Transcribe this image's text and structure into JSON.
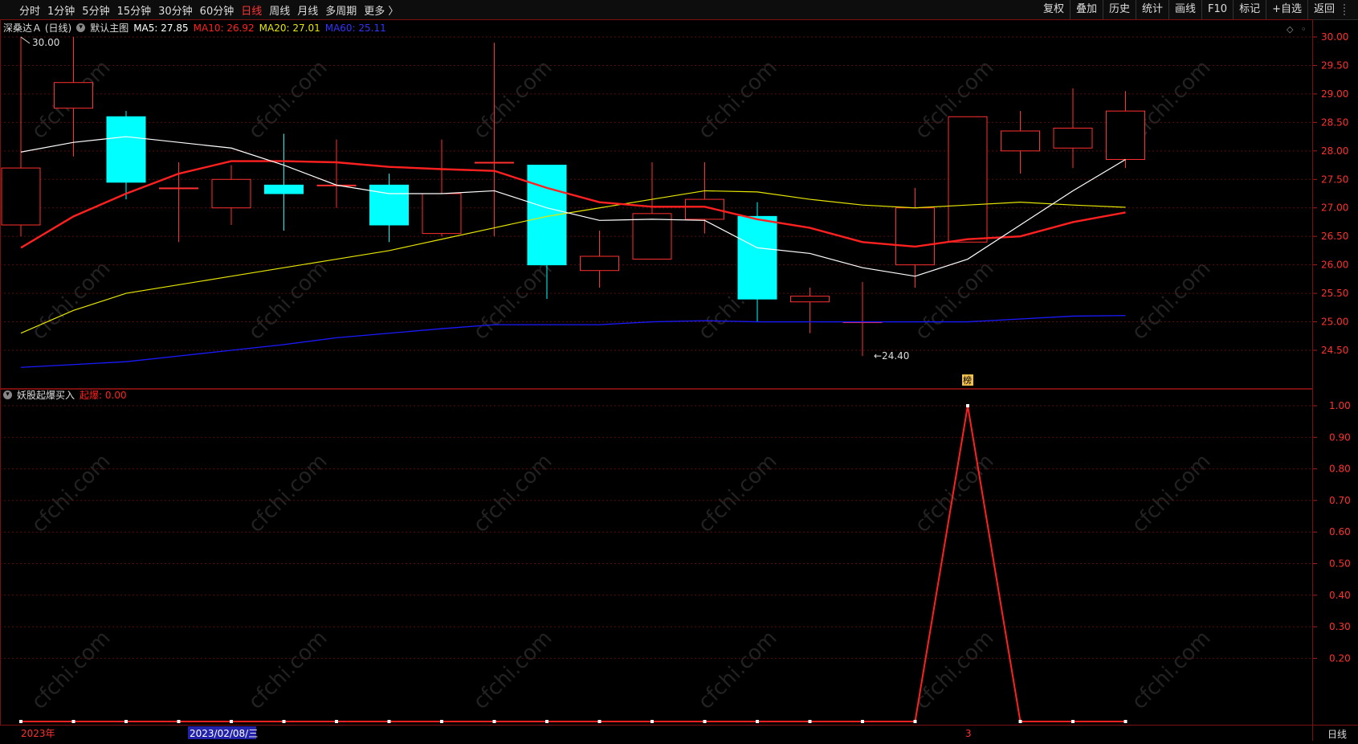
{
  "toolbar": {
    "periods": [
      "分时",
      "1分钟",
      "5分钟",
      "15分钟",
      "30分钟",
      "60分钟",
      "日线",
      "周线",
      "月线",
      "多周期",
      "更多 〉"
    ],
    "active_period": "日线",
    "right_buttons": [
      "复权",
      "叠加",
      "历史",
      "统计",
      "画线",
      "F10",
      "+自选",
      "返回"
    ],
    "mark_label": "标记"
  },
  "main_legend": {
    "stock": "深桑达Ａ (日线)",
    "template": "默认主图",
    "ma5": "MA5: 27.85",
    "ma10": "MA10: 26.92",
    "ma20": "MA20: 27.01",
    "ma60": "MA60: 25.11",
    "colors": {
      "ma5": "#ffffff",
      "ma10": "#ff2020",
      "ma20": "#e6e600",
      "ma60": "#1a1aff"
    }
  },
  "price_axis": {
    "labels": [
      "30.00",
      "29.50",
      "29.00",
      "28.50",
      "28.00",
      "27.50",
      "27.00",
      "26.50",
      "26.00",
      "25.50",
      "25.00",
      "24.50"
    ],
    "values": [
      30.0,
      29.5,
      29.0,
      28.5,
      28.0,
      27.5,
      27.0,
      26.5,
      26.0,
      25.5,
      25.0,
      24.5
    ]
  },
  "price_annotations": {
    "high": "30.00",
    "low": "24.40"
  },
  "sub_legend": {
    "indicator": "妖股起爆买入",
    "value": "起爆: 0.00"
  },
  "sub_axis": {
    "labels": [
      "1.00",
      "0.90",
      "0.80",
      "0.70",
      "0.60",
      "0.50",
      "0.40",
      "0.30",
      "0.20"
    ],
    "values": [
      1.0,
      0.9,
      0.8,
      0.7,
      0.6,
      0.5,
      0.4,
      0.3,
      0.2
    ]
  },
  "date_axis": {
    "year_label": "2023年",
    "cursor_date": "2023/02/08/三",
    "month_label": "3"
  },
  "badge": "榜",
  "bottom_tab": "日线",
  "watermark": "cfchi.com",
  "chart_data": {
    "type": "candlestick",
    "candles": [
      {
        "open": 26.7,
        "close": 27.7,
        "high": 30.0,
        "low": 26.5
      },
      {
        "open": 28.75,
        "close": 29.2,
        "high": 30.0,
        "low": 27.9
      },
      {
        "open": 28.6,
        "close": 27.45,
        "high": 28.7,
        "low": 27.15
      },
      {
        "open": 27.35,
        "close": 27.35,
        "high": 27.8,
        "low": 26.4
      },
      {
        "open": 27.0,
        "close": 27.5,
        "high": 27.75,
        "low": 26.7
      },
      {
        "open": 27.4,
        "close": 27.25,
        "high": 28.3,
        "low": 26.6
      },
      {
        "open": 27.4,
        "close": 27.4,
        "high": 28.2,
        "low": 27.0
      },
      {
        "open": 27.4,
        "close": 26.7,
        "high": 27.6,
        "low": 26.4
      },
      {
        "open": 26.55,
        "close": 27.25,
        "high": 28.2,
        "low": 26.5
      },
      {
        "open": 27.8,
        "close": 27.8,
        "high": 29.9,
        "low": 26.5
      },
      {
        "open": 27.75,
        "close": 26.0,
        "high": 27.75,
        "low": 25.4
      },
      {
        "open": 25.9,
        "close": 26.15,
        "high": 26.6,
        "low": 25.6
      },
      {
        "open": 26.1,
        "close": 26.9,
        "high": 27.8,
        "low": 26.1
      },
      {
        "open": 26.8,
        "close": 27.15,
        "high": 27.8,
        "low": 26.55
      },
      {
        "open": 26.85,
        "close": 25.4,
        "high": 27.1,
        "low": 25.0
      },
      {
        "open": 25.35,
        "close": 25.45,
        "high": 25.6,
        "low": 24.8
      },
      {
        "open": 25.0,
        "close": 25.0,
        "high": 25.7,
        "low": 24.4
      },
      {
        "open": 26.0,
        "close": 27.0,
        "high": 27.35,
        "low": 25.6
      },
      {
        "open": 26.4,
        "close": 28.6,
        "high": 28.6,
        "low": 26.4
      },
      {
        "open": 28.0,
        "close": 28.35,
        "high": 28.7,
        "low": 27.6
      },
      {
        "open": 28.05,
        "close": 28.4,
        "high": 29.1,
        "low": 27.7
      },
      {
        "open": 27.85,
        "close": 28.7,
        "high": 29.05,
        "low": 27.7
      }
    ],
    "ma5": [
      27.98,
      28.15,
      28.25,
      null,
      28.05,
      27.75,
      27.4,
      27.25,
      27.25,
      27.3,
      27.0,
      26.78,
      26.8,
      26.78,
      26.3,
      26.2,
      25.95,
      25.8,
      26.1,
      26.7,
      27.3,
      27.85
    ],
    "ma10": [
      26.3,
      26.85,
      27.25,
      27.6,
      27.82,
      27.82,
      27.8,
      27.72,
      27.68,
      27.65,
      27.35,
      27.1,
      27.02,
      27.02,
      26.8,
      26.65,
      26.4,
      26.32,
      26.45,
      26.5,
      26.75,
      26.92
    ],
    "ma20": [
      24.8,
      25.2,
      25.5,
      25.65,
      25.8,
      25.95,
      26.1,
      26.25,
      26.45,
      26.65,
      26.85,
      27.0,
      27.15,
      27.3,
      27.28,
      27.15,
      27.05,
      27.0,
      27.05,
      27.1,
      27.05,
      27.01
    ],
    "ma60": [
      24.2,
      24.25,
      24.3,
      24.4,
      24.5,
      24.6,
      24.72,
      24.8,
      24.88,
      24.95,
      24.95,
      24.95,
      25.0,
      25.02,
      25.0,
      25.0,
      25.0,
      25.0,
      25.0,
      25.05,
      25.1,
      25.11
    ],
    "indicator": [
      0,
      0,
      0,
      0,
      0,
      0,
      0,
      0,
      0,
      0,
      0,
      0,
      0,
      0,
      0,
      0,
      0,
      0,
      1,
      0,
      0,
      0
    ],
    "up_color": "#ff3030",
    "down_color": "#00ffff"
  }
}
